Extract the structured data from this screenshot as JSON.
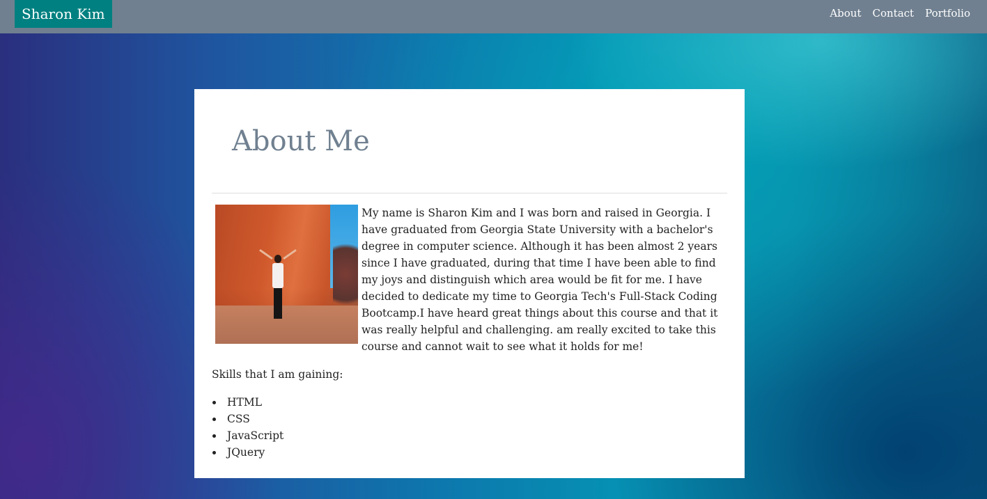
{
  "navbar": {
    "brand": "Sharon Kim",
    "links": [
      "About",
      "Contact",
      "Portfolio"
    ]
  },
  "main": {
    "title": "About Me",
    "bio": "My name is Sharon Kim and I was born and raised in Georgia. I have graduated from Georgia State University with a bachelor's degree in computer science. Although it has been almost 2 years since I have graduated, during that time I have been able to find my joys and distinguish which area would be fit for me. I have decided to dedicate my time to Georgia Tech's Full-Stack Coding Bootcamp.I have heard great things about this course and that it was really helpful and challenging. am really excited to take this course and cannot wait to see what it holds for me!",
    "skills_heading": "Skills that I am gaining:",
    "skills": [
      "HTML",
      "CSS",
      "JavaScript",
      "JQuery"
    ]
  },
  "colors": {
    "navbar": "#708090",
    "brand": "#008080",
    "title": "#708090"
  }
}
